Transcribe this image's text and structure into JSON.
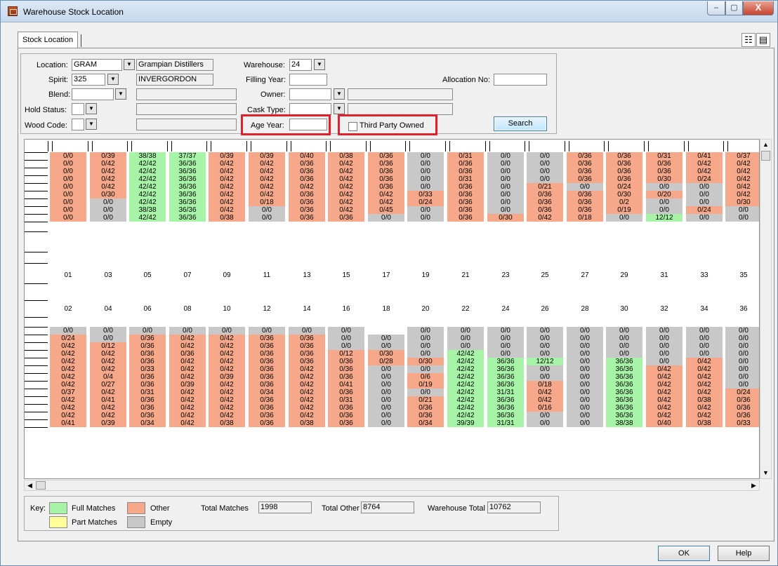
{
  "window": {
    "title": "Warehouse Stock Location",
    "min": "–",
    "max": "▢",
    "close": "X"
  },
  "tab": {
    "label": "Stock Location"
  },
  "tools": {
    "layout_icon": "☷",
    "print_icon": "▤"
  },
  "form": {
    "location_label": "Location:",
    "location_value": "GRAM",
    "location_desc": "Grampian Distillers",
    "spirit_label": "Spirit:",
    "spirit_value": "325",
    "spirit_desc": "INVERGORDON",
    "blend_label": "Blend:",
    "hold_label": "Hold Status:",
    "wood_label": "Wood Code:",
    "warehouse_label": "Warehouse:",
    "warehouse_value": "24",
    "filling_label": "Filling Year:",
    "owner_label": "Owner:",
    "cask_label": "Cask Type:",
    "age_label": "Age Year:",
    "third_party_label": "Third Party Owned",
    "allocation_label": "Allocation No:",
    "search_label": "Search"
  },
  "colors": {
    "full": "#a7f3a7",
    "part": "#ffff99",
    "other": "#f7a88a",
    "empty": "#c8c8c8"
  },
  "grid": {
    "top_rows": [
      [
        "o:0/0",
        "o:0/39",
        "f:38/38",
        "f:37/37",
        "o:0/39",
        "o:0/39",
        "o:0/40",
        "o:0/38",
        "o:0/36",
        "e:0/0",
        "o:0/31",
        "e:0/0",
        "e:0/0",
        "o:0/36",
        "o:0/36",
        "o:0/31",
        "o:0/41",
        "o:0/37"
      ],
      [
        "o:0/0",
        "o:0/42",
        "f:42/42",
        "f:36/36",
        "o:0/42",
        "o:0/42",
        "o:0/36",
        "o:0/42",
        "o:0/36",
        "e:0/0",
        "o:0/36",
        "e:0/0",
        "e:0/0",
        "o:0/36",
        "o:0/36",
        "o:0/36",
        "o:0/42",
        "o:0/42"
      ],
      [
        "o:0/0",
        "o:0/42",
        "f:42/42",
        "f:36/36",
        "o:0/42",
        "o:0/42",
        "o:0/36",
        "o:0/42",
        "o:0/36",
        "e:0/0",
        "o:0/36",
        "e:0/0",
        "e:0/0",
        "o:0/36",
        "o:0/36",
        "o:0/36",
        "o:0/42",
        "o:0/42"
      ],
      [
        "o:0/0",
        "o:0/42",
        "f:42/42",
        "f:36/36",
        "o:0/42",
        "o:0/42",
        "o:0/36",
        "o:0/42",
        "o:0/36",
        "e:0/0",
        "o:0/31",
        "e:0/0",
        "e:0/0",
        "o:0/36",
        "o:0/36",
        "o:0/30",
        "o:0/24",
        "o:0/42"
      ],
      [
        "o:0/0",
        "o:0/42",
        "f:42/42",
        "f:36/36",
        "o:0/42",
        "o:0/42",
        "o:0/42",
        "o:0/42",
        "o:0/36",
        "e:0/0",
        "o:0/36",
        "e:0/0",
        "o:0/21",
        "e:0/0",
        "o:0/24",
        "e:0/0",
        "e:0/0",
        "o:0/42"
      ],
      [
        "o:0/0",
        "o:0/30",
        "f:42/42",
        "f:36/36",
        "o:0/42",
        "o:0/42",
        "o:0/36",
        "o:0/42",
        "o:0/42",
        "o:0/33",
        "o:0/36",
        "e:0/0",
        "o:0/36",
        "o:0/36",
        "o:0/30",
        "o:0/20",
        "e:0/0",
        "o:0/42"
      ],
      [
        "o:0/0",
        "e:0/0",
        "f:42/42",
        "f:36/36",
        "o:0/42",
        "o:0/18",
        "o:0/36",
        "o:0/42",
        "o:0/42",
        "o:0/24",
        "o:0/36",
        "e:0/0",
        "o:0/36",
        "o:0/36",
        "o:0/2",
        "e:0/0",
        "e:0/0",
        "o:0/30"
      ],
      [
        "o:0/0",
        "e:0/0",
        "f:38/38",
        "f:36/36",
        "o:0/42",
        "e:0/0",
        "o:0/36",
        "o:0/42",
        "o:0/45",
        "e:0/0",
        "o:0/36",
        "e:0/0",
        "o:0/36",
        "o:0/36",
        "o:0/19",
        "e:0/0",
        "o:0/24",
        "e:0/0"
      ],
      [
        "o:0/0",
        "e:0/0",
        "f:42/42",
        "f:36/36",
        "o:0/38",
        "e:0/0",
        "o:0/36",
        "o:0/36",
        "e:0/0",
        "e:0/0",
        "o:0/36",
        "o:0/30",
        "o:0/42",
        "o:0/18",
        "e:0/0",
        "f:12/12",
        "e:0/0",
        "e:0/0"
      ]
    ],
    "odd_numbers": [
      "01",
      "03",
      "05",
      "07",
      "09",
      "11",
      "13",
      "15",
      "17",
      "19",
      "21",
      "23",
      "25",
      "27",
      "29",
      "31",
      "33",
      "35"
    ],
    "even_numbers": [
      "02",
      "04",
      "06",
      "08",
      "10",
      "12",
      "14",
      "16",
      "18",
      "20",
      "22",
      "24",
      "26",
      "28",
      "30",
      "32",
      "34",
      "36"
    ],
    "bottom_rows": [
      [
        "e:0/0",
        "e:0/0",
        "e:0/0",
        "e:0/0",
        "e:0/0",
        "e:0/0",
        "e:0/0",
        "e:0/0",
        "w:",
        "e:0/0",
        "e:0/0",
        "e:0/0",
        "e:0/0",
        "e:0/0",
        "e:0/0",
        "e:0/0",
        "e:0/0",
        "e:0/0"
      ],
      [
        "o:0/24",
        "e:0/0",
        "o:0/36",
        "o:0/42",
        "o:0/42",
        "o:0/36",
        "o:0/36",
        "e:0/0",
        "e:0/0",
        "e:0/0",
        "e:0/0",
        "e:0/0",
        "e:0/0",
        "e:0/0",
        "e:0/0",
        "e:0/0",
        "e:0/0",
        "e:0/0"
      ],
      [
        "o:0/42",
        "o:0/12",
        "o:0/36",
        "o:0/42",
        "o:0/42",
        "o:0/36",
        "o:0/36",
        "e:0/0",
        "e:0/0",
        "e:0/0",
        "e:0/0",
        "e:0/0",
        "e:0/0",
        "e:0/0",
        "e:0/0",
        "e:0/0",
        "e:0/0",
        "e:0/0"
      ],
      [
        "o:0/42",
        "o:0/42",
        "o:0/36",
        "o:0/36",
        "o:0/42",
        "o:0/36",
        "o:0/36",
        "o:0/12",
        "o:0/30",
        "e:0/0",
        "f:42/42",
        "e:0/0",
        "e:0/0",
        "e:0/0",
        "e:0/0",
        "e:0/0",
        "e:0/0",
        "e:0/0"
      ],
      [
        "o:0/42",
        "o:0/42",
        "o:0/36",
        "o:0/42",
        "o:0/42",
        "o:0/36",
        "o:0/36",
        "o:0/36",
        "o:0/28",
        "o:0/30",
        "f:42/42",
        "f:36/36",
        "f:12/12",
        "e:0/0",
        "f:36/36",
        "e:0/0",
        "o:0/42",
        "e:0/0"
      ],
      [
        "o:0/42",
        "o:0/42",
        "o:0/33",
        "o:0/42",
        "o:0/42",
        "o:0/36",
        "o:0/42",
        "o:0/36",
        "e:0/0",
        "e:0/0",
        "f:42/42",
        "f:36/36",
        "e:0/0",
        "e:0/0",
        "f:36/36",
        "o:0/42",
        "o:0/42",
        "e:0/0"
      ],
      [
        "o:0/42",
        "o:0/4",
        "o:0/36",
        "o:0/42",
        "o:0/39",
        "o:0/36",
        "o:0/42",
        "o:0/36",
        "e:0/0",
        "o:0/6",
        "f:42/42",
        "f:36/36",
        "e:0/0",
        "e:0/0",
        "f:36/36",
        "o:0/42",
        "o:0/42",
        "e:0/0"
      ],
      [
        "o:0/42",
        "o:0/27",
        "o:0/36",
        "o:0/39",
        "o:0/42",
        "o:0/36",
        "o:0/42",
        "o:0/41",
        "e:0/0",
        "o:0/19",
        "f:42/42",
        "f:36/36",
        "o:0/18",
        "e:0/0",
        "f:36/36",
        "o:0/42",
        "o:0/42",
        "e:0/0"
      ],
      [
        "o:0/37",
        "o:0/42",
        "o:0/31",
        "o:0/42",
        "o:0/42",
        "o:0/34",
        "o:0/42",
        "o:0/36",
        "e:0/0",
        "e:0/0",
        "f:42/42",
        "f:31/31",
        "o:0/42",
        "e:0/0",
        "f:36/36",
        "o:0/42",
        "o:0/42",
        "o:0/24"
      ],
      [
        "o:0/42",
        "o:0/41",
        "o:0/36",
        "o:0/42",
        "o:0/42",
        "o:0/36",
        "o:0/42",
        "o:0/31",
        "e:0/0",
        "o:0/21",
        "f:42/42",
        "f:36/36",
        "o:0/42",
        "e:0/0",
        "f:36/36",
        "o:0/42",
        "o:0/38",
        "o:0/36"
      ],
      [
        "o:0/42",
        "o:0/42",
        "o:0/36",
        "o:0/42",
        "o:0/42",
        "o:0/36",
        "o:0/42",
        "o:0/36",
        "e:0/0",
        "o:0/36",
        "f:42/42",
        "f:36/36",
        "o:0/16",
        "e:0/0",
        "f:36/36",
        "o:0/42",
        "o:0/42",
        "o:0/36"
      ],
      [
        "o:0/42",
        "o:0/42",
        "o:0/36",
        "o:0/42",
        "o:0/42",
        "o:0/36",
        "o:0/42",
        "o:0/36",
        "e:0/0",
        "o:0/36",
        "f:42/42",
        "f:36/36",
        "e:0/0",
        "e:0/0",
        "f:36/36",
        "o:0/42",
        "o:0/42",
        "o:0/36"
      ],
      [
        "o:0/41",
        "o:0/39",
        "o:0/34",
        "o:0/42",
        "o:0/38",
        "o:0/36",
        "o:0/38",
        "o:0/36",
        "e:0/0",
        "o:0/34",
        "f:39/39",
        "f:31/31",
        "e:0/0",
        "e:0/0",
        "f:38/38",
        "o:0/40",
        "o:0/38",
        "o:0/33"
      ]
    ]
  },
  "key": {
    "label": "Key:",
    "full": "Full Matches",
    "part": "Part Matches",
    "other": "Other",
    "empty": "Empty",
    "total_matches_label": "Total Matches",
    "total_matches": "1998",
    "total_other_label": "Total Other",
    "total_other": "8764",
    "warehouse_total_label": "Warehouse Total",
    "warehouse_total": "10762"
  },
  "buttons": {
    "ok": "OK",
    "help": "Help"
  }
}
